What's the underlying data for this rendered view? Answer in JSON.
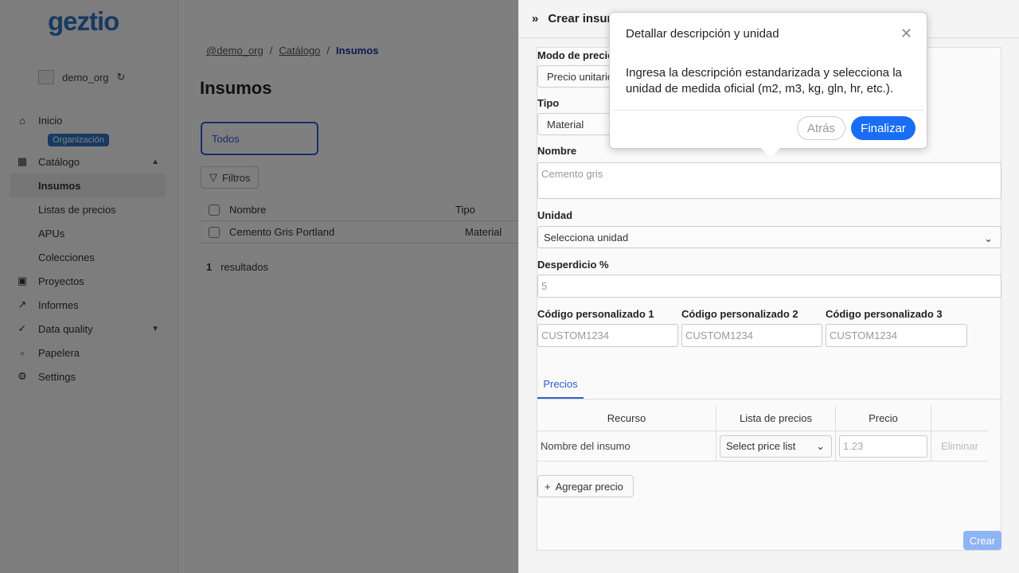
{
  "sidebar": {
    "logo": "geztio",
    "org_name": "demo_org",
    "org_badge": "Organización",
    "items": [
      {
        "label": "Inicio"
      },
      {
        "label": "Catálogo"
      },
      {
        "label": "Insumos"
      },
      {
        "label": "Listas de precios"
      },
      {
        "label": "APUs"
      },
      {
        "label": "Colecciones"
      },
      {
        "label": "Proyectos"
      },
      {
        "label": "Informes"
      },
      {
        "label": "Data quality"
      },
      {
        "label": "Papelera"
      },
      {
        "label": "Settings"
      }
    ]
  },
  "main": {
    "breadcrumb": [
      "@demo_org",
      "Catálogo",
      "Insumos"
    ],
    "title": "Insumos",
    "tab_all": "Todos",
    "filters": "Filtros",
    "columns": [
      "Nombre",
      "Tipo"
    ],
    "rows": [
      {
        "nombre": "Cemento Gris Portland",
        "tipo": "Material"
      }
    ],
    "results_count": "1",
    "results_label": "resultados"
  },
  "drawer": {
    "title": "Crear insumo",
    "labels": {
      "modo": "Modo de precio",
      "tipo": "Tipo",
      "nombre": "Nombre",
      "unidad": "Unidad",
      "desperdicio": "Desperdicio %",
      "cod1": "Código personalizado 1",
      "cod2": "Código personalizado 2",
      "cod3": "Código personalizado 3"
    },
    "modo_value": "Precio unitario",
    "tipo_value": "Material",
    "nombre_placeholder": "Cemento gris",
    "unidad_value": "Selecciona unidad",
    "desperdicio_placeholder": "5",
    "cod_placeholder": "CUSTOM1234",
    "prices_tab": "Precios",
    "price_columns": [
      "Recurso",
      "Lista de precios",
      "Precio"
    ],
    "price_row": {
      "recurso": "Nombre del insumo",
      "lista": "Select price list",
      "precio_placeholder": "1.23",
      "delete": "Eliminar"
    },
    "add_price": "Agregar precio",
    "create": "Crear"
  },
  "popover": {
    "title": "Detallar descripción y unidad",
    "body": "Ingresa la descripción estandarizada y selecciona la unidad de medida oficial (m2, m3, kg, gln, hr, etc.).",
    "back": "Atrás",
    "finish": "Finalizar"
  }
}
